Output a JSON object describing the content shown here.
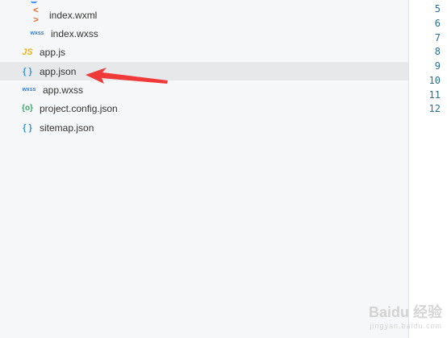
{
  "explorer": {
    "files": [
      {
        "icon": "xml-icon",
        "glyph": "< >",
        "label": "index.wxml"
      },
      {
        "icon": "wxss-icon",
        "glyph": "wxss",
        "label": "index.wxss"
      },
      {
        "icon": "js-icon",
        "glyph": "JS",
        "label": "app.js"
      },
      {
        "icon": "json-icon",
        "glyph": "{ }",
        "label": "app.json"
      },
      {
        "icon": "wxss-icon",
        "glyph": "wxss",
        "label": "app.wxss"
      },
      {
        "icon": "config-icon",
        "glyph": "{o}",
        "label": "project.config.json"
      },
      {
        "icon": "json-icon",
        "glyph": "{ }",
        "label": "sitemap.json"
      }
    ],
    "selected": "app.json"
  },
  "editor": {
    "line_numbers": [
      "5",
      "6",
      "7",
      "8",
      "9",
      "10",
      "11",
      "12"
    ]
  },
  "watermark": {
    "text": "Baidu 经验",
    "sub": "jingyan.baidu.com"
  },
  "colors": {
    "arrow": "#f03a3a",
    "selected_row": "#e6e8ea",
    "line_number": "#2a6f8f"
  }
}
